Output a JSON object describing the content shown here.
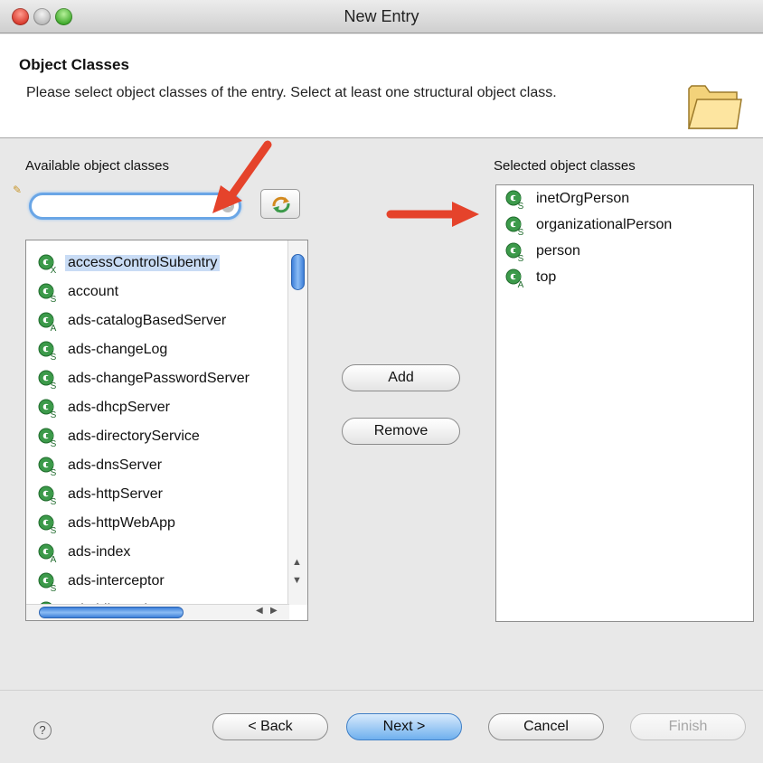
{
  "window": {
    "title": "New Entry"
  },
  "header": {
    "title": "Object Classes",
    "description": "Please select object classes of the entry. Select at least one structural object class."
  },
  "available": {
    "label": "Available object classes",
    "filter_value": "",
    "items": [
      {
        "label": "accessControlSubentry",
        "kind": "X"
      },
      {
        "label": "account",
        "kind": "S"
      },
      {
        "label": "ads-catalogBasedServer",
        "kind": "A"
      },
      {
        "label": "ads-changeLog",
        "kind": "S"
      },
      {
        "label": "ads-changePasswordServer",
        "kind": "S"
      },
      {
        "label": "ads-dhcpServer",
        "kind": "S"
      },
      {
        "label": "ads-directoryService",
        "kind": "S"
      },
      {
        "label": "ads-dnsServer",
        "kind": "S"
      },
      {
        "label": "ads-httpServer",
        "kind": "S"
      },
      {
        "label": "ads-httpWebApp",
        "kind": "S"
      },
      {
        "label": "ads-index",
        "kind": "A"
      },
      {
        "label": "ads-interceptor",
        "kind": "S"
      },
      {
        "label": "ads-jdbmIndex",
        "kind": "S"
      }
    ]
  },
  "selected": {
    "label": "Selected object classes",
    "items": [
      {
        "label": "inetOrgPerson",
        "kind": "S"
      },
      {
        "label": "organizationalPerson",
        "kind": "S"
      },
      {
        "label": "person",
        "kind": "S"
      },
      {
        "label": "top",
        "kind": "A"
      }
    ]
  },
  "buttons": {
    "add": "Add",
    "remove": "Remove",
    "back": "< Back",
    "next": "Next >",
    "cancel": "Cancel",
    "finish": "Finish",
    "help": "?"
  },
  "icons": {
    "object_class": "object-class-icon",
    "folder": "folder-icon",
    "refresh": "refresh-icon",
    "help": "help-icon"
  },
  "colors": {
    "object_class_green": "#3c9a4a",
    "annotation_arrow": "#e5432b",
    "focus_blue": "#6aa6e6",
    "selection": "#c9dcf5"
  }
}
